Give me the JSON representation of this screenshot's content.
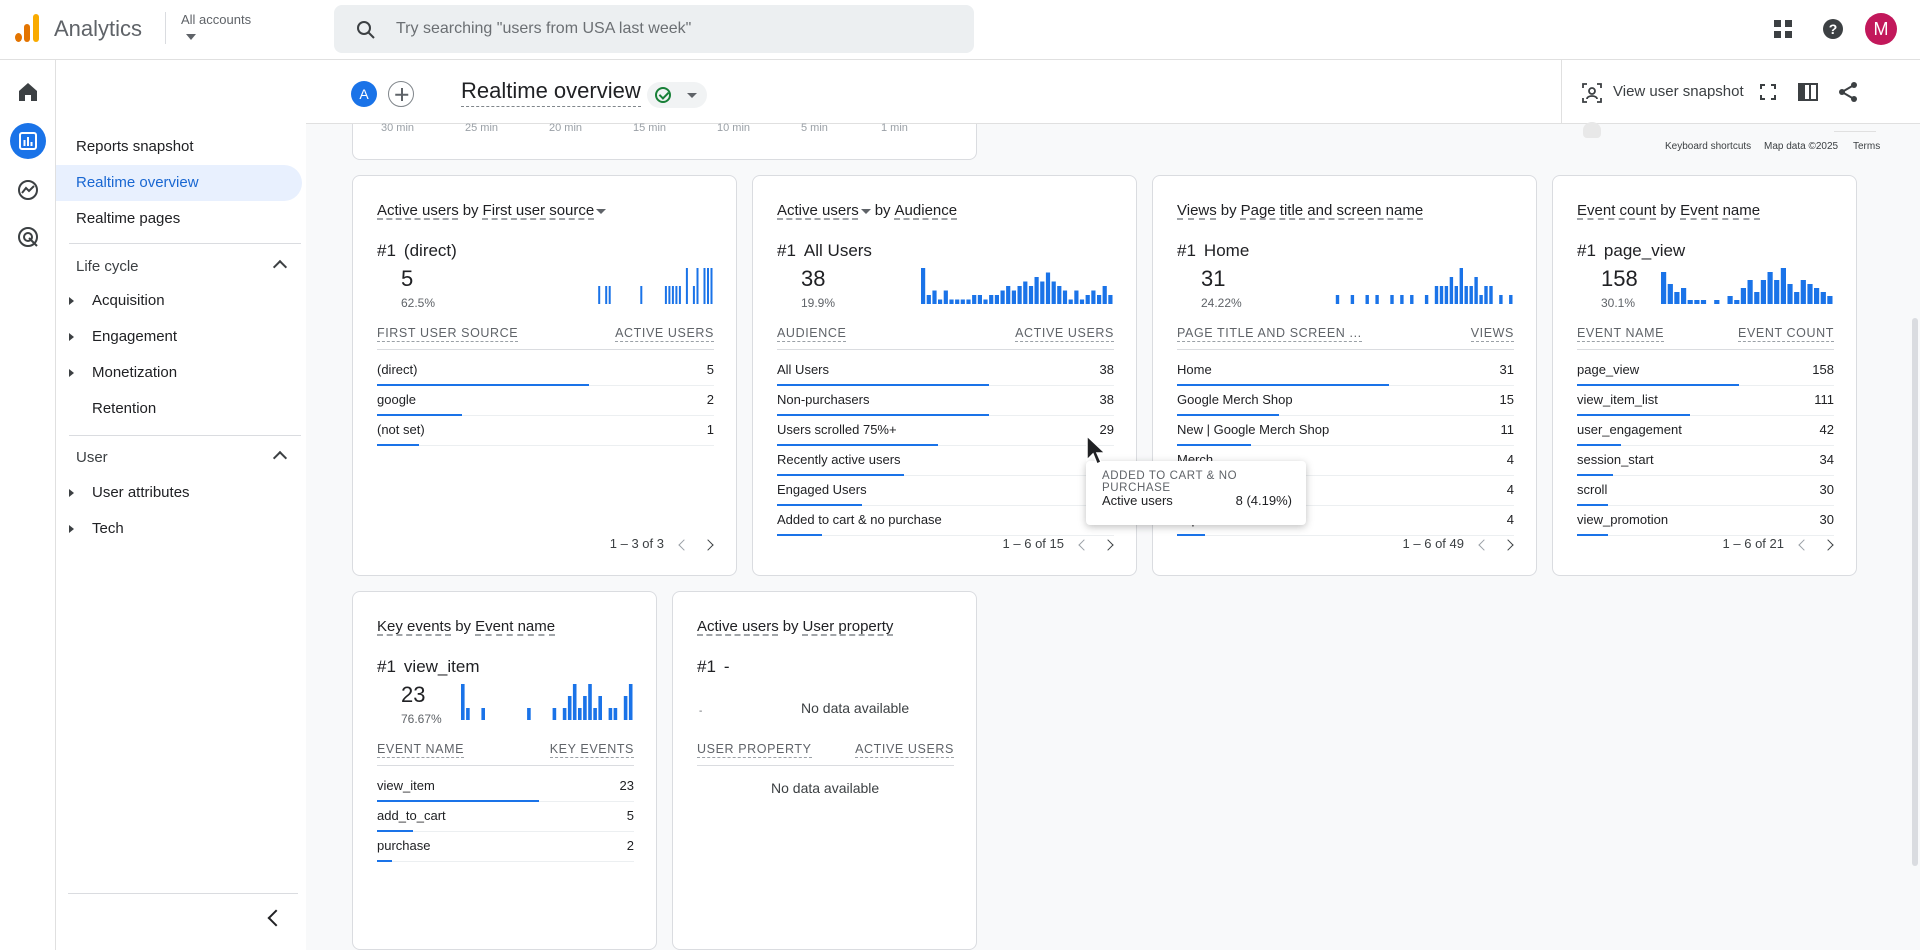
{
  "topbar": {
    "app_name": "Analytics",
    "accounts_label": "All accounts",
    "search_placeholder": "Try searching \"users from USA last week\"",
    "avatar_initial": "M"
  },
  "header": {
    "compare_badge": "A",
    "title": "Realtime overview",
    "snapshot_label": "View user snapshot"
  },
  "nav": {
    "items": [
      {
        "label": "Reports snapshot"
      },
      {
        "label": "Realtime overview"
      },
      {
        "label": "Realtime pages"
      }
    ],
    "lifecycle": {
      "title": "Life cycle",
      "items": [
        {
          "label": "Acquisition"
        },
        {
          "label": "Engagement"
        },
        {
          "label": "Monetization"
        },
        {
          "label": "Retention"
        }
      ]
    },
    "user": {
      "title": "User",
      "items": [
        {
          "label": "User attributes"
        },
        {
          "label": "Tech"
        }
      ]
    }
  },
  "map": {
    "axis_labels": [
      "30 min",
      "25 min",
      "20 min",
      "15 min",
      "10 min",
      "5 min",
      "1 min"
    ],
    "footer": [
      "Keyboard shortcuts",
      "Map data ©2025",
      "Terms"
    ]
  },
  "colors": {
    "accent": "#1a73e8",
    "active_nav_bg": "#e8f0fe",
    "brand_orange": "#f9ab00",
    "brand_dark_orange": "#e37400",
    "avatar": "#c2185b"
  },
  "cards": [
    {
      "metric": "Active users",
      "by": "by",
      "dimension": "First user source",
      "metric_dropdown": false,
      "dimension_dropdown": true,
      "rank": "#1",
      "top_name": "(direct)",
      "top_value": "5",
      "top_pct": "62.5%",
      "spark": [
        0,
        0,
        0,
        0,
        0,
        0,
        0,
        0,
        0,
        0,
        0,
        0,
        0,
        0,
        0,
        0,
        0,
        0,
        0,
        0,
        0,
        0,
        1,
        0,
        1,
        1,
        0,
        0,
        0,
        0,
        0,
        0,
        0,
        0,
        1,
        0,
        0,
        0,
        0,
        0,
        0,
        1,
        1,
        1,
        1,
        1,
        0,
        2,
        0,
        1,
        2,
        0,
        2,
        2,
        2
      ],
      "col_left": "FIRST USER SOURCE",
      "col_right": "ACTIVE USERS",
      "rows": [
        {
          "name": "(direct)",
          "value": "5",
          "share": 1.0
        },
        {
          "name": "google",
          "value": "2",
          "share": 0.4
        },
        {
          "name": "(not set)",
          "value": "1",
          "share": 0.2
        }
      ],
      "pager": "1 – 3 of 3"
    },
    {
      "metric": "Active users",
      "by": "by",
      "dimension": "Audience",
      "metric_dropdown": true,
      "dimension_dropdown": false,
      "rank": "#1",
      "top_name": "All Users",
      "top_value": "38",
      "top_pct": "19.9%",
      "spark": [
        8,
        2,
        3,
        1,
        3,
        1,
        1,
        1,
        1,
        2,
        2,
        1,
        2,
        2,
        3,
        4,
        3,
        4,
        5,
        4,
        6,
        5,
        7,
        5,
        4,
        3,
        1,
        3,
        1,
        2,
        3,
        2,
        4,
        2
      ],
      "col_left": "AUDIENCE",
      "col_right": "ACTIVE USERS",
      "rows": [
        {
          "name": "All Users",
          "value": "38",
          "share": 1.0
        },
        {
          "name": "Non-purchasers",
          "value": "38",
          "share": 1.0
        },
        {
          "name": "Users scrolled 75%+",
          "value": "29",
          "share": 0.76
        },
        {
          "name": "Recently active users",
          "value": "",
          "share": 0.6
        },
        {
          "name": "Engaged Users",
          "value": "",
          "share": 0.4
        },
        {
          "name": "Added to cart & no purchase",
          "value": "",
          "share": 0.21
        }
      ],
      "pager": "1 – 6 of 15"
    },
    {
      "metric": "Views",
      "by": "by",
      "dimension": "Page title and screen name",
      "metric_dropdown": false,
      "dimension_dropdown": false,
      "rank": "#1",
      "top_name": "Home",
      "top_value": "31",
      "top_pct": "24.22%",
      "spark": [
        0,
        0,
        0,
        1,
        0,
        0,
        1,
        0,
        0,
        1,
        0,
        1,
        0,
        0,
        1,
        0,
        1,
        0,
        1,
        0,
        0,
        1,
        0,
        2,
        2,
        2,
        3,
        2,
        4,
        2,
        2,
        3,
        1,
        2,
        2,
        0,
        1,
        0,
        1
      ],
      "col_left": "PAGE TITLE AND SCREEN ...",
      "col_right": "VIEWS",
      "rows": [
        {
          "name": "Home",
          "value": "31",
          "share": 1.0
        },
        {
          "name": "Google Merch Shop",
          "value": "15",
          "share": 0.48
        },
        {
          "name": "New | Google Merch Shop",
          "value": "11",
          "share": 0.35
        },
        {
          "name": "Merch ...",
          "value": "4",
          "share": 0.13
        },
        {
          "name": "n Shop",
          "value": "4",
          "share": 0.13
        },
        {
          "name": "hop",
          "value": "4",
          "share": 0.13
        }
      ],
      "pager": "1 – 6 of 49"
    },
    {
      "metric": "Event count",
      "by": "by",
      "dimension": "Event name",
      "metric_dropdown": false,
      "dimension_dropdown": false,
      "rank": "#1",
      "top_name": "page_view",
      "top_value": "158",
      "top_pct": "30.1%",
      "spark": [
        8,
        5,
        3,
        4,
        1,
        1,
        1,
        0,
        1,
        0,
        2,
        1,
        4,
        6,
        3,
        6,
        8,
        6,
        9,
        5,
        3,
        6,
        5,
        4,
        3,
        2
      ],
      "col_left": "EVENT NAME",
      "col_right": "EVENT COUNT",
      "rows": [
        {
          "name": "page_view",
          "value": "158",
          "share": 1.0
        },
        {
          "name": "view_item_list",
          "value": "111",
          "share": 0.7
        },
        {
          "name": "user_engagement",
          "value": "42",
          "share": 0.27
        },
        {
          "name": "session_start",
          "value": "34",
          "share": 0.22
        },
        {
          "name": "scroll",
          "value": "30",
          "share": 0.19
        },
        {
          "name": "view_promotion",
          "value": "30",
          "share": 0.19
        }
      ],
      "pager": "1 – 6 of 21"
    },
    {
      "metric": "Key events",
      "by": "by",
      "dimension": "Event name",
      "metric_dropdown": false,
      "dimension_dropdown": false,
      "rank": "#1",
      "top_name": "view_item",
      "top_value": "23",
      "top_pct": "76.67%",
      "spark": [
        3,
        1,
        0,
        0,
        1,
        0,
        0,
        0,
        0,
        0,
        0,
        0,
        0,
        1,
        0,
        0,
        0,
        0,
        1,
        0,
        1,
        2,
        3,
        1,
        2,
        3,
        1,
        2,
        0,
        1,
        1,
        0,
        2,
        3
      ],
      "col_left": "EVENT NAME",
      "col_right": "KEY EVENTS",
      "rows": [
        {
          "name": "view_item",
          "value": "23",
          "share": 1.0
        },
        {
          "name": "add_to_cart",
          "value": "5",
          "share": 0.22
        },
        {
          "name": "purchase",
          "value": "2",
          "share": 0.09
        }
      ],
      "pager": ""
    },
    {
      "metric": "Active users",
      "by": "by",
      "dimension": "User property",
      "metric_dropdown": false,
      "dimension_dropdown": false,
      "rank": "#1",
      "top_name": "-",
      "top_value": "",
      "top_pct": "",
      "spark_label": "-",
      "spark_nodata": "No data available",
      "spark": [],
      "col_left": "USER PROPERTY",
      "col_right": "ACTIVE USERS",
      "rows": [],
      "table_nodata": "No data available",
      "pager": ""
    }
  ],
  "tooltip": {
    "title": "ADDED TO CART & NO PURCHASE",
    "label": "Active users",
    "value": "8 (4.19%)"
  }
}
